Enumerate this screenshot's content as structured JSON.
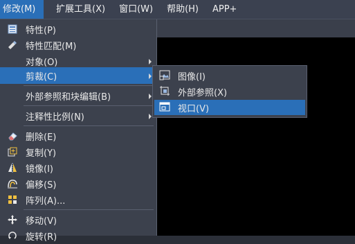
{
  "menubar": {
    "items": [
      {
        "label": "修改(M)",
        "active": true
      },
      {
        "label": "扩展工具(X)"
      },
      {
        "label": "窗口(W)"
      },
      {
        "label": "帮助(H)"
      },
      {
        "label": "APP+"
      }
    ]
  },
  "modify_menu": {
    "items": [
      {
        "label": "特性(P)",
        "icon": "properties-icon"
      },
      {
        "label": "特性匹配(M)",
        "icon": "match-properties-brush-icon"
      },
      {
        "label": "对象(O)",
        "submenu": true
      },
      {
        "label": "剪裁(C)",
        "submenu": true,
        "highlighted": true
      },
      {
        "label": "外部参照和块编辑(B)",
        "submenu": true
      },
      {
        "label": "注释性比例(N)",
        "submenu": true
      },
      {
        "label": "删除(E)",
        "icon": "eraser-icon"
      },
      {
        "label": "复制(Y)",
        "icon": "copy-icon"
      },
      {
        "label": "镜像(I)",
        "icon": "mirror-icon"
      },
      {
        "label": "偏移(S)",
        "icon": "offset-icon"
      },
      {
        "label": "阵列(A)...",
        "icon": "array-icon"
      },
      {
        "label": "移动(V)",
        "icon": "move-icon"
      },
      {
        "label": "旋转(R)",
        "icon": "rotate-icon"
      }
    ]
  },
  "clip_submenu": {
    "items": [
      {
        "label": "图像(I)",
        "icon": "image-clip-icon"
      },
      {
        "label": "外部参照(X)",
        "icon": "xref-clip-icon"
      },
      {
        "label": "视口(V)",
        "icon": "viewport-clip-icon",
        "highlighted": true
      }
    ]
  },
  "colors": {
    "highlight": "#2a6fb8",
    "menu_bg": "#3c414d",
    "canvas": "#000000"
  }
}
